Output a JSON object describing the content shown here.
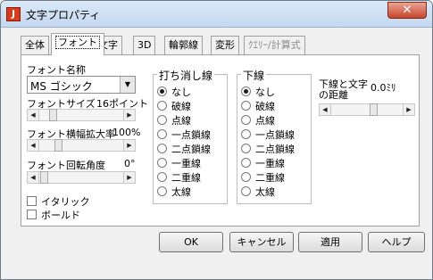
{
  "window": {
    "title": "文字プロパティ",
    "icon": "J",
    "close": "✕"
  },
  "tabs": [
    {
      "label": "全体"
    },
    {
      "label": "フォント"
    },
    {
      "label": "文字"
    },
    {
      "label": "3D"
    },
    {
      "label": "輪郭線"
    },
    {
      "label": "変形"
    },
    {
      "label": "ｸｴﾘｰ/計算式"
    }
  ],
  "font_panel": {
    "font_name_label": "フォント名称",
    "font_name_value": "MS ゴシック",
    "size_label": "フォントサイズ",
    "size_value": "16ポイント",
    "width_label": "フォント横幅拡大率",
    "width_value": "100%",
    "rotation_label": "フォント回転角度",
    "rotation_value": "0°",
    "italic_label": "イタリック",
    "bold_label": "ボールド"
  },
  "strike": {
    "title": "打ち消し線",
    "options": [
      "なし",
      "破線",
      "点線",
      "一点鎖線",
      "二点鎖線",
      "一重線",
      "二重線",
      "太線"
    ],
    "selected": "なし"
  },
  "underline": {
    "title": "下線",
    "options": [
      "なし",
      "破線",
      "点線",
      "一点鎖線",
      "二点鎖線",
      "一重線",
      "二重線",
      "太線"
    ],
    "selected": "なし"
  },
  "underline_distance": {
    "label_line1": "下線と文字",
    "label_line2": "の距離",
    "value": "0.0ﾐﾘ"
  },
  "buttons": {
    "ok": "OK",
    "cancel": "キャンセル",
    "apply": "適用",
    "help": "ヘルプ"
  }
}
